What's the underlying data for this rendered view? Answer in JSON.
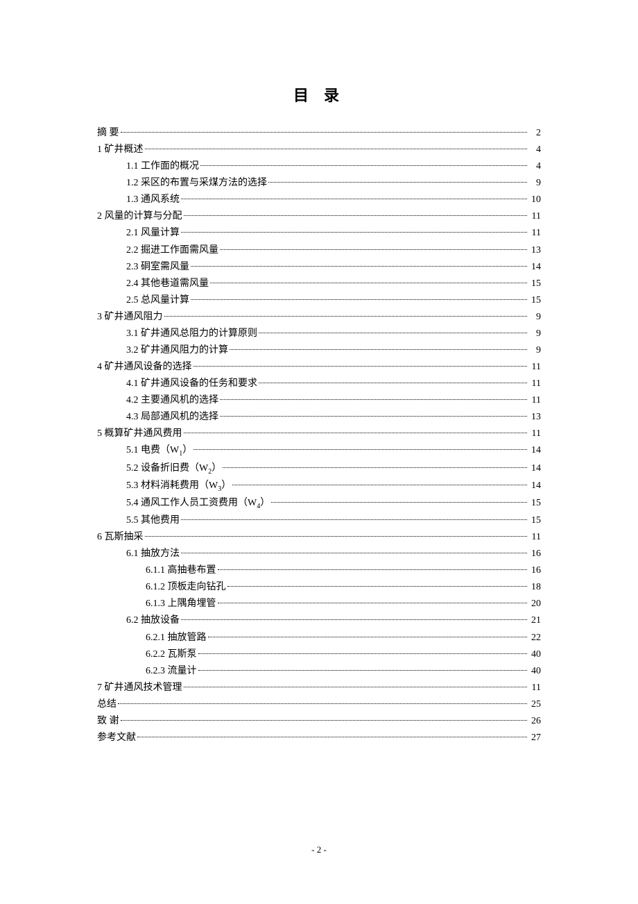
{
  "title": "目 录",
  "pageFooter": "- 2 -",
  "entries": [
    {
      "label": "摘  要",
      "page": "2",
      "indent": 0
    },
    {
      "label": "1 矿井概述",
      "page": "4",
      "indent": 0
    },
    {
      "label": "1.1 工作面的概况",
      "page": "4",
      "indent": 1
    },
    {
      "label": "1.2 采区的布置与采煤方法的选择",
      "page": "9",
      "indent": 1
    },
    {
      "label": "1.3 通风系统",
      "page": "10",
      "indent": 1
    },
    {
      "label": "2 风量的计算与分配",
      "page": "11",
      "indent": 0
    },
    {
      "label": "2.1 风量计算",
      "page": "11",
      "indent": 1
    },
    {
      "label": "2.2 掘进工作面需风量",
      "page": "13",
      "indent": 1
    },
    {
      "label": "2.3 硐室需风量",
      "page": "14",
      "indent": 1
    },
    {
      "label": "2.4 其他巷道需风量",
      "page": "15",
      "indent": 1
    },
    {
      "label": "2.5 总风量计算",
      "page": "15",
      "indent": 1
    },
    {
      "label": "3 矿井通风阻力",
      "page": "9",
      "indent": 0
    },
    {
      "label": "3.1 矿井通风总阻力的计算原则",
      "page": "9",
      "indent": 1
    },
    {
      "label": "3.2 矿井通风阻力的计算",
      "page": "9",
      "indent": 1
    },
    {
      "label": "4 矿井通风设备的选择",
      "page": "11",
      "indent": 0
    },
    {
      "label": "4.1 矿井通风设备的任务和要求",
      "page": "11",
      "indent": 1
    },
    {
      "label": "4.2 主要通风机的选择",
      "page": "11",
      "indent": 1
    },
    {
      "label": "4.3 局部通风机的选择",
      "page": "13",
      "indent": 1
    },
    {
      "label": "5 概算矿井通风费用",
      "page": "11",
      "indent": 0
    },
    {
      "label": "5.1 电费（W₁）",
      "page": "14",
      "indent": 1
    },
    {
      "label": "5.2 设备折旧费（W₂）",
      "page": "14",
      "indent": 1
    },
    {
      "label": "5.3 材料消耗费用（W₃）",
      "page": "14",
      "indent": 1
    },
    {
      "label": "5.4 通风工作人员工资费用（W₄）",
      "page": "15",
      "indent": 1
    },
    {
      "label": "5.5 其他费用",
      "page": "15",
      "indent": 1
    },
    {
      "label": "6 瓦斯抽采",
      "page": "11",
      "indent": 0
    },
    {
      "label": "6.1 抽放方法",
      "page": "16",
      "indent": 1
    },
    {
      "label": "6.1.1 高抽巷布置",
      "page": "16",
      "indent": 2
    },
    {
      "label": "6.1.2 顶板走向钻孔",
      "page": "18",
      "indent": 2
    },
    {
      "label": "6.1.3 上隅角埋管",
      "page": "20",
      "indent": 2
    },
    {
      "label": "6.2 抽放设备",
      "page": "21",
      "indent": 1
    },
    {
      "label": "6.2.1 抽放管路",
      "page": "22",
      "indent": 2
    },
    {
      "label": "6.2.2 瓦斯泵",
      "page": "40",
      "indent": 2
    },
    {
      "label": "6.2.3 流量计",
      "page": "40",
      "indent": 2
    },
    {
      "label": "7 矿井通风技术管理",
      "page": "11",
      "indent": 0
    },
    {
      "label": "总结",
      "page": "25",
      "indent": 0
    },
    {
      "label": "致 谢",
      "page": "26",
      "indent": 0
    },
    {
      "label": "参考文献",
      "page": "27",
      "indent": 0
    }
  ]
}
